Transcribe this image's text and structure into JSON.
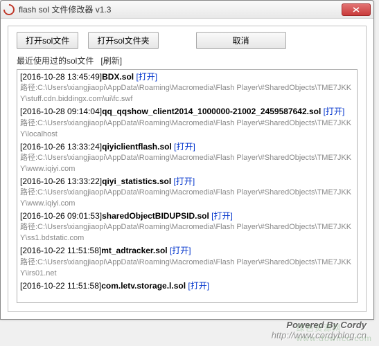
{
  "window": {
    "title": "flash sol 文件修改器 v1.3"
  },
  "toolbar": {
    "open_file": "打开sol文件",
    "open_folder": "打开sol文件夹",
    "cancel": "取消"
  },
  "recent": {
    "label": "最近使用过的sol文件",
    "refresh": "[刷新]",
    "open_text": "[打开]",
    "path_prefix": "路径:",
    "items": [
      {
        "ts": "[2016-10-28 13:45:49]",
        "name": "BDX.sol",
        "path": "C:\\Users\\xiangjiaopi\\AppData\\Roaming\\Macromedia\\Flash Player\\#SharedObjects\\TME7JKKY\\stuff.cdn.biddingx.com\\ui\\fc.swf"
      },
      {
        "ts": "[2016-10-28 09:14:04]",
        "name": "qq_qqshow_client2014_1000000-21002_2459587642.sol",
        "path": "C:\\Users\\xiangjiaopi\\AppData\\Roaming\\Macromedia\\Flash Player\\#SharedObjects\\TME7JKKY\\localhost"
      },
      {
        "ts": "[2016-10-26 13:33:24]",
        "name": "qiyiclientflash.sol",
        "path": "C:\\Users\\xiangjiaopi\\AppData\\Roaming\\Macromedia\\Flash Player\\#SharedObjects\\TME7JKKY\\www.iqiyi.com"
      },
      {
        "ts": "[2016-10-26 13:33:22]",
        "name": "qiyi_statistics.sol",
        "path": "C:\\Users\\xiangjiaopi\\AppData\\Roaming\\Macromedia\\Flash Player\\#SharedObjects\\TME7JKKY\\www.iqiyi.com"
      },
      {
        "ts": "[2016-10-26 09:01:53]",
        "name": "sharedObjectBIDUPSID.sol",
        "path": "C:\\Users\\xiangjiaopi\\AppData\\Roaming\\Macromedia\\Flash Player\\#SharedObjects\\TME7JKKY\\ss1.bdstatic.com"
      },
      {
        "ts": "[2016-10-22 11:51:58]",
        "name": "mt_adtracker.sol",
        "path": "C:\\Users\\xiangjiaopi\\AppData\\Roaming\\Macromedia\\Flash Player\\#SharedObjects\\TME7JKKY\\irs01.net"
      },
      {
        "ts": "[2016-10-22 11:51:58]",
        "name": "com.letv.storage.l.sol",
        "path": ""
      }
    ]
  },
  "footer": {
    "powered": "Powered By Cordy",
    "url": "http://www.cordyblog.cn",
    "watermark_cn": "绿色资源网",
    "watermark_url": "www.downcc.com"
  }
}
